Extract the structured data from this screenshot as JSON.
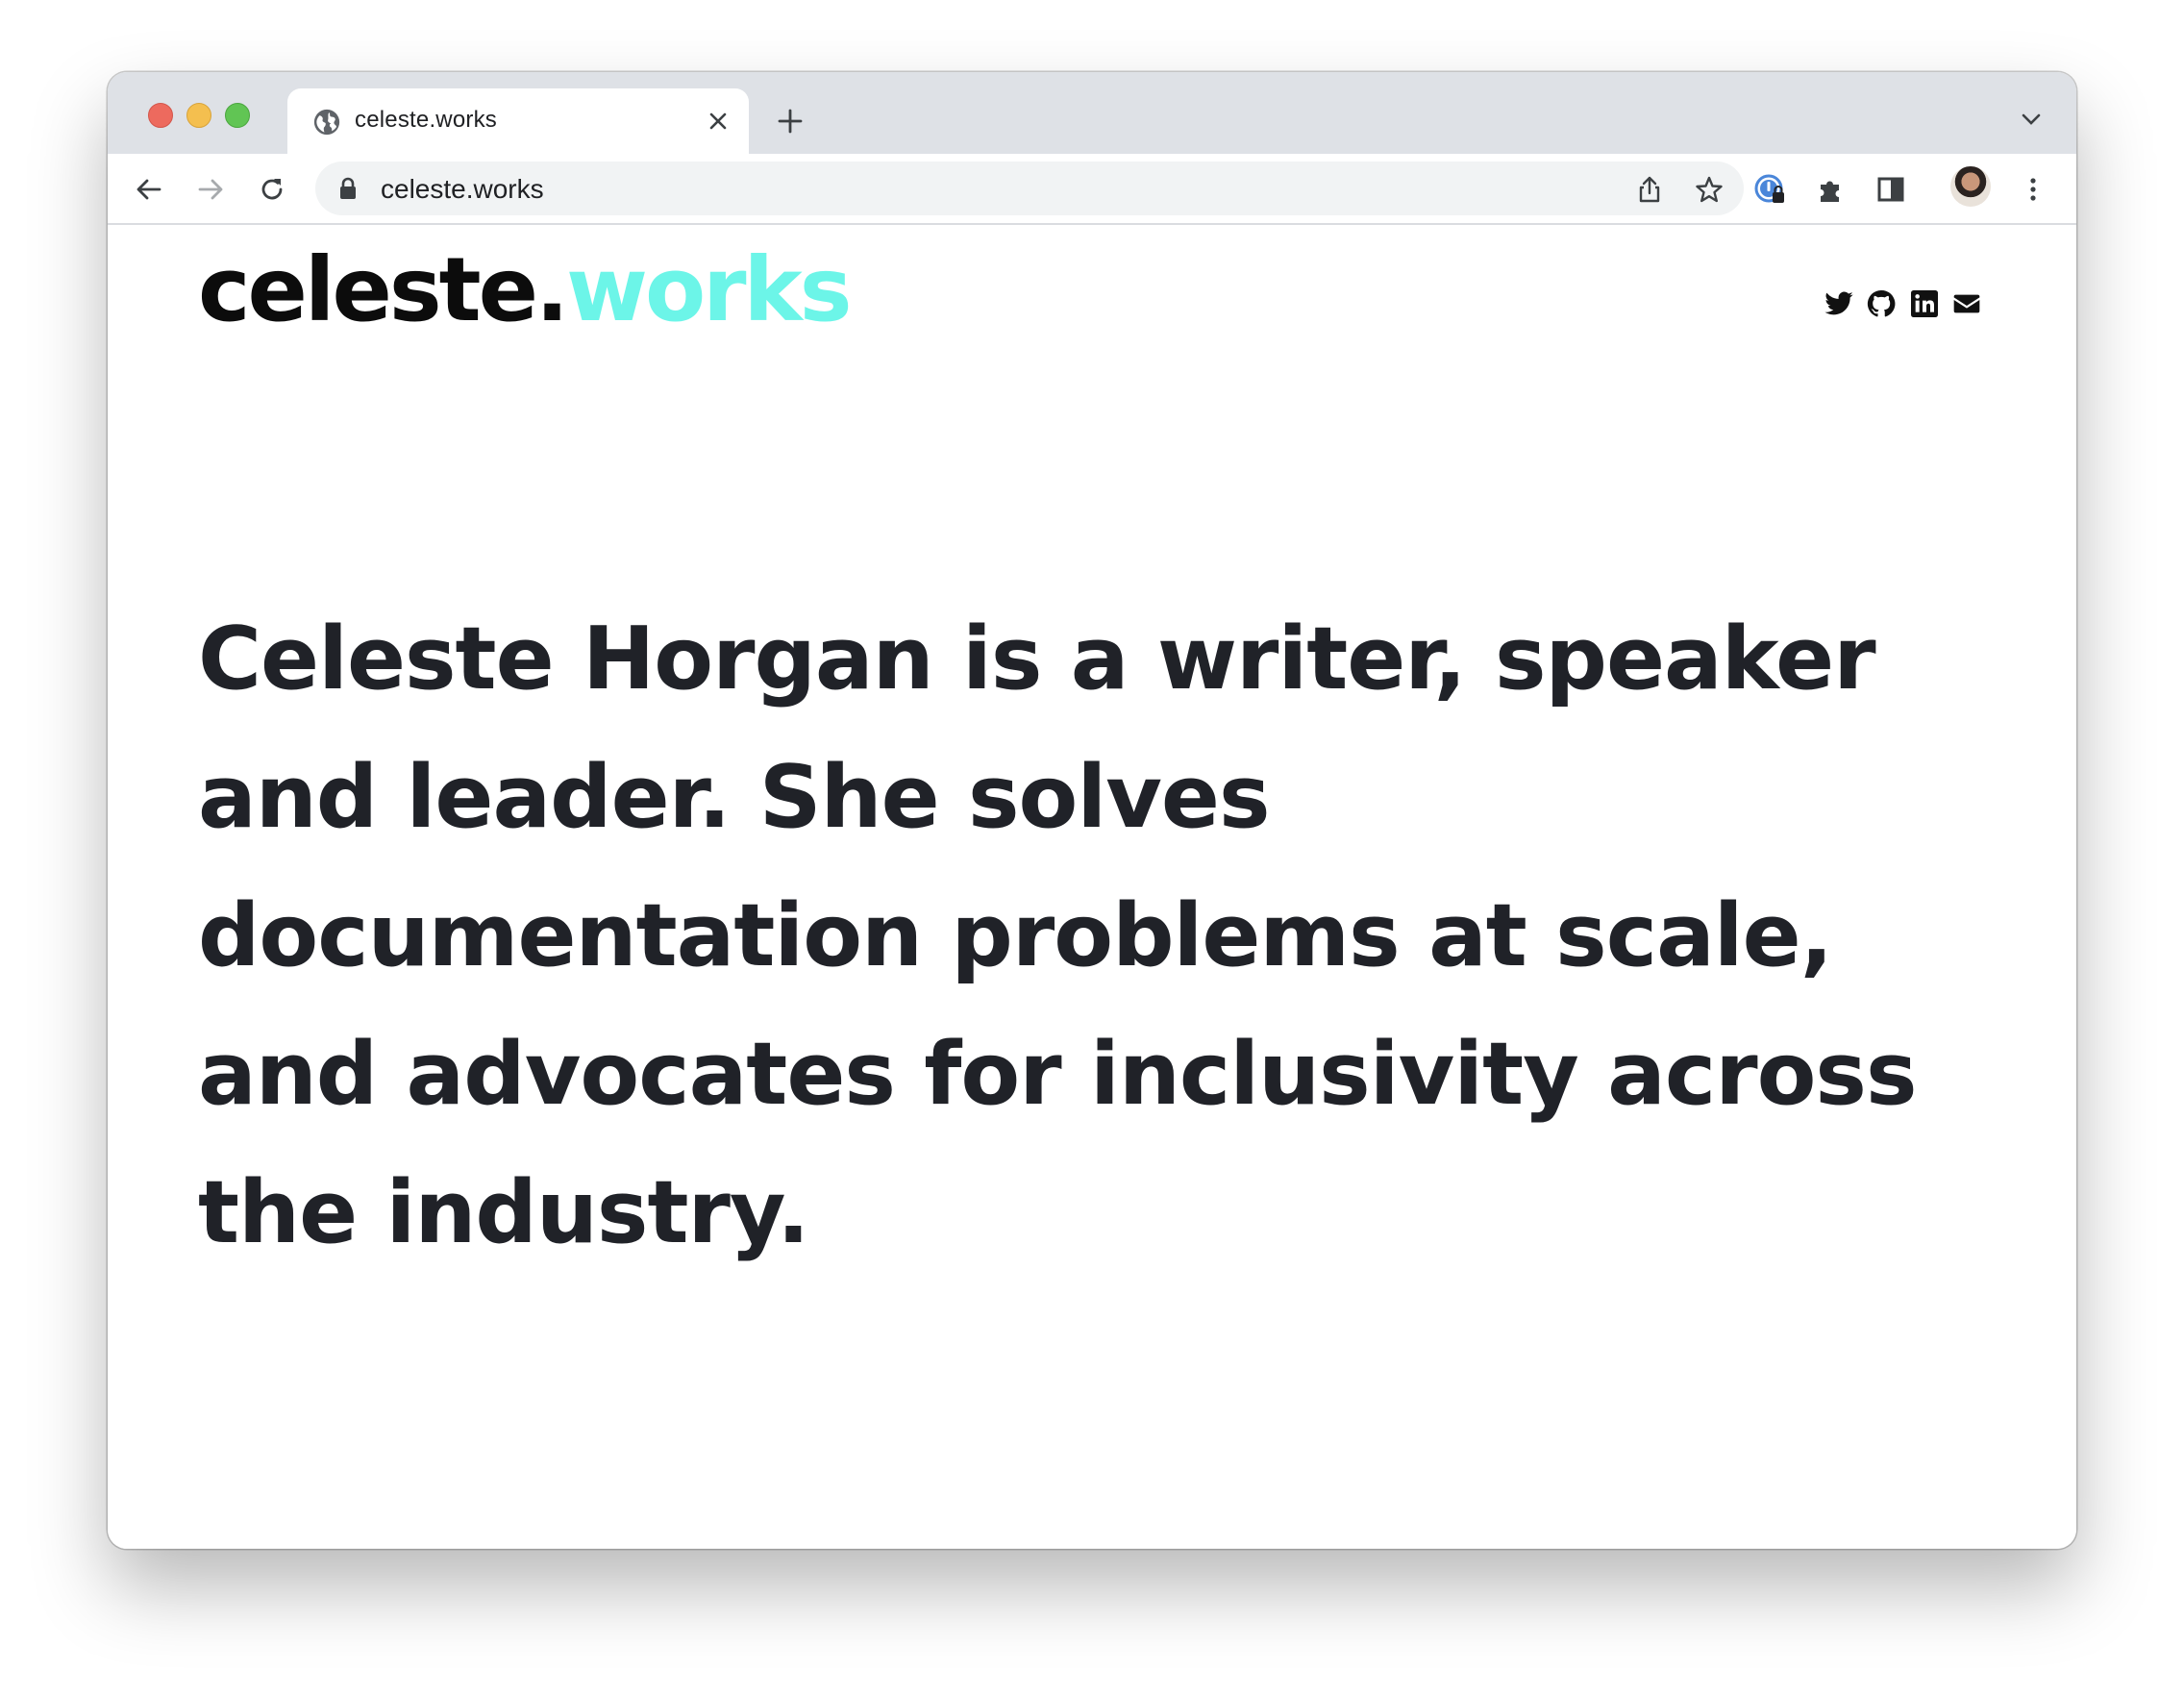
{
  "browser": {
    "tab_title": "celeste.works",
    "url": "celeste.works",
    "colors": {
      "tabbar": "#dee1e6",
      "omnibox": "#f1f3f4"
    }
  },
  "site": {
    "logo_main": "celeste.",
    "logo_accent": "works",
    "accent_color": "#6cf5e8",
    "social_icons": [
      "twitter-icon",
      "github-icon",
      "linkedin-icon",
      "mail-icon"
    ],
    "hero_text": "Celeste Horgan is a writer, speaker and leader. She solves documentation problems at scale, and advocates for inclusivity across the industry."
  }
}
